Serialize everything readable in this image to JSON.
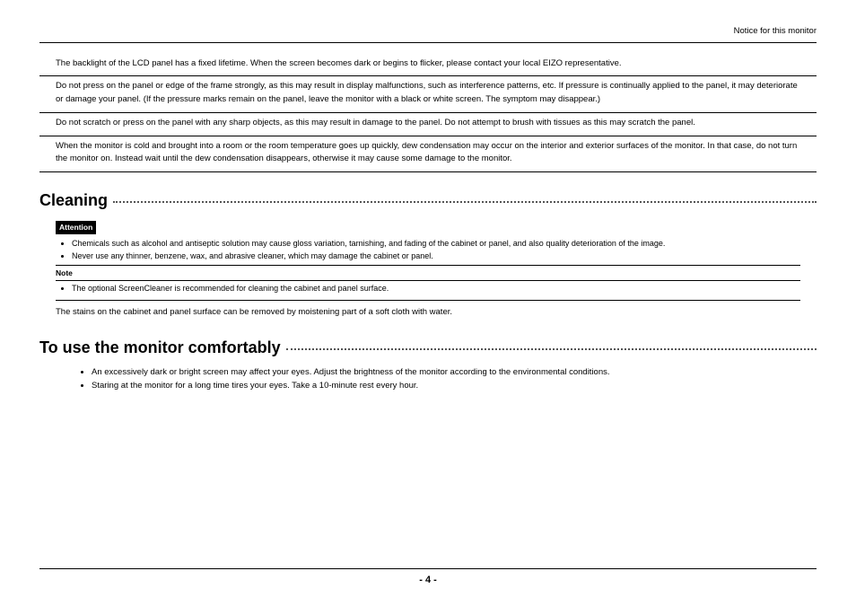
{
  "header": {
    "notice": "Notice for this monitor"
  },
  "paras": {
    "p1": "The backlight of the LCD panel has a fixed lifetime. When the screen becomes dark or begins to flicker, please contact your local EIZO representative.",
    "p2": "Do not press on the panel or edge of the frame strongly, as this may result in display malfunctions, such as interference patterns, etc. If pressure is continually applied to the panel, it may deteriorate or damage your panel. (If the pressure marks remain on the panel, leave the monitor with a black or white screen. The symptom may disappear.)",
    "p3": "Do not scratch or press on the panel with any sharp objects, as this may result in damage to the panel. Do not attempt to brush with tissues as this may scratch the panel.",
    "p4": "When the monitor is cold and brought into a room or the room temperature goes up quickly, dew condensation may occur on the interior and exterior surfaces of the monitor. In that case, do not turn the monitor on. Instead wait until the dew condensation disappears, otherwise it may cause some damage to the monitor."
  },
  "cleaning": {
    "title": "Cleaning",
    "attention_label": "Attention",
    "attention_items": {
      "a1": "Chemicals such as alcohol and antiseptic solution may cause gloss variation, tarnishing, and fading of the cabinet or panel, and also quality deterioration of the image.",
      "a2": "Never use any thinner, benzene, wax, and abrasive cleaner, which may damage the cabinet or panel."
    },
    "note_label": "Note",
    "note_items": {
      "n1": "The optional ScreenCleaner is recommended for cleaning the cabinet and panel surface."
    },
    "body": "The stains on the cabinet and panel surface can be removed by moistening part of a soft cloth with water."
  },
  "comfort": {
    "title": "To use the monitor comfortably",
    "items": {
      "c1": "An excessively dark or bright screen may affect your eyes. Adjust the brightness of the monitor according to the environmental conditions.",
      "c2": "Staring at the monitor for a long time tires your eyes. Take a 10-minute rest every hour."
    }
  },
  "footer": {
    "page": "- 4 -"
  }
}
